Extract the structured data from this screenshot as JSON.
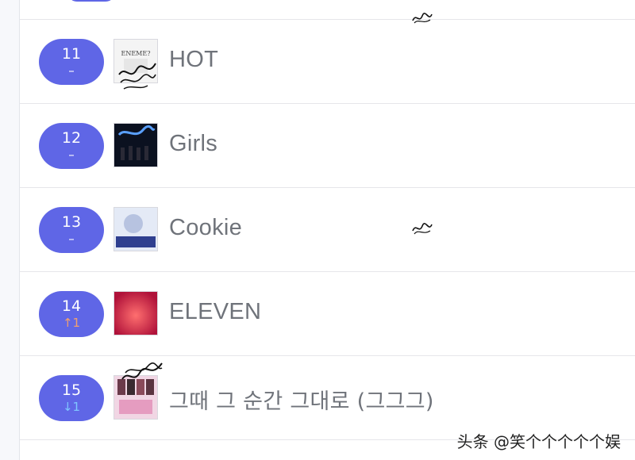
{
  "chart_list": {
    "rows": [
      {
        "rank": "11",
        "change": "–",
        "change_type": "same",
        "title": "HOT",
        "cover_color": "#f2f2f2"
      },
      {
        "rank": "12",
        "change": "–",
        "change_type": "same",
        "title": "Girls",
        "cover_color": "#0b1120"
      },
      {
        "rank": "13",
        "change": "–",
        "change_type": "same",
        "title": "Cookie",
        "cover_color": "#dfe6f3"
      },
      {
        "rank": "14",
        "change": "↑1",
        "change_type": "up",
        "title": "ELEVEN",
        "cover_color": "#d3244a"
      },
      {
        "rank": "15",
        "change": "↓1",
        "change_type": "down",
        "title": "그때 그 순간 그대로 (그그그)",
        "cover_color": "#d9a7c5"
      }
    ]
  },
  "watermark": {
    "text": "头条 @笑个个个个个娱"
  },
  "colors": {
    "rank_pill": "#5f66e6",
    "title_text": "#6f737a",
    "up": "#f0a070",
    "down": "#7fc6ff"
  }
}
